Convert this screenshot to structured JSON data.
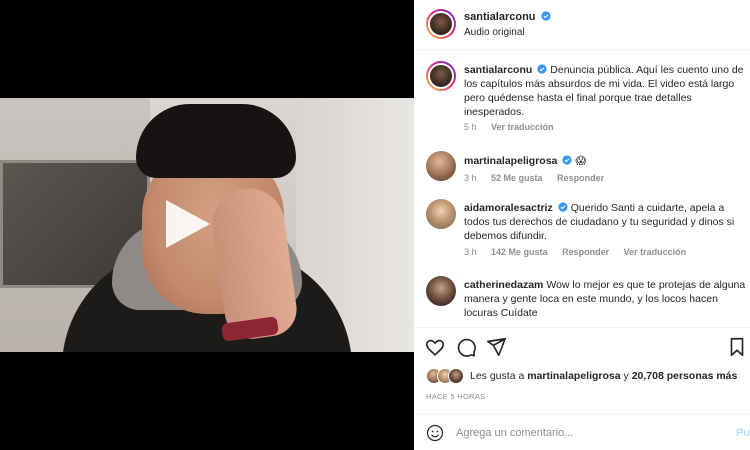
{
  "post": {
    "username": "santialarconu",
    "audio": "Audio original"
  },
  "caption": {
    "username": "santialarconu",
    "text": "Denuncia pública. Aquí les cuento uno de los capítulos más absurdos de mi vida. El video está largo pero quédense hasta el final porque trae detalles inesperados.",
    "time": "5 h",
    "translate": "Ver traducción"
  },
  "comments": [
    {
      "username": "martinalapeligrosa",
      "text": "😱",
      "time": "3 h",
      "likes": "52 Me gusta",
      "reply": "Responder"
    },
    {
      "username": "aidamoralesactriz",
      "text": "Querido Santi a cuidarte, apela a todos tus derechos de ciudadano y tu seguridad y dinos si debemos difundir.",
      "time": "3 h",
      "likes": "142 Me gusta",
      "reply": "Responder",
      "translate": "Ver traducción"
    },
    {
      "username": "catherinedazam",
      "text": "Wow lo mejor es que te protejas de alguna manera y gente loca en este mundo, y los locos hacen locuras Cuídate"
    }
  ],
  "likes": {
    "prefix": "Les gusta a",
    "user": "martinalapeligrosa",
    "conjunction": "y",
    "count": "20,708 personas más"
  },
  "timestamp": "HACE 5 HORAS",
  "add_comment": {
    "placeholder": "Agrega un comentario...",
    "post_label": "Pu"
  },
  "colors": {
    "verified": "#3897f0",
    "muted_text": "#8e8e8e",
    "post_disabled": "#b2dffc"
  },
  "icons": [
    "play-icon",
    "mute-icon",
    "verified-icon",
    "heart-icon",
    "comment-icon",
    "share-icon",
    "bookmark-icon",
    "emoji-icon"
  ]
}
